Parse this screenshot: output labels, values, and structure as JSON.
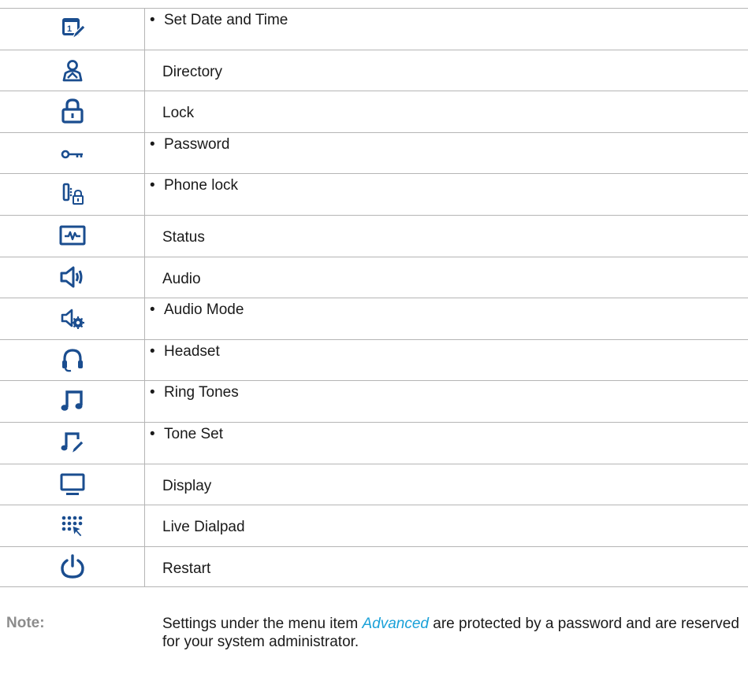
{
  "rows": [
    {
      "label": "Set Date and Time",
      "bullet": "•",
      "icon": "calendar-edit-icon"
    },
    {
      "label": "Directory",
      "icon": "directory-icon"
    },
    {
      "label": "Lock",
      "icon": "lock-icon"
    },
    {
      "label": "Password",
      "bullet": "•",
      "icon": "key-icon"
    },
    {
      "label": "Phone lock",
      "bullet": "•",
      "icon": "phone-lock-icon"
    },
    {
      "label": "Status",
      "icon": "status-monitor-icon"
    },
    {
      "label": "Audio",
      "icon": "speaker-icon"
    },
    {
      "label": "Audio Mode",
      "bullet": "•",
      "icon": "audio-mode-icon"
    },
    {
      "label": "Headset",
      "bullet": "•",
      "icon": "headset-icon"
    },
    {
      "label": "Ring Tones",
      "bullet": "•",
      "icon": "music-note-icon"
    },
    {
      "label": "Tone Set",
      "bullet": "•",
      "icon": "tone-set-icon"
    },
    {
      "label": "Display",
      "icon": "display-icon"
    },
    {
      "label": "Live Dialpad",
      "icon": "live-dialpad-icon"
    },
    {
      "label": "Restart",
      "icon": "power-icon"
    }
  ],
  "note": {
    "label": "Note:",
    "text_before": "Settings under the menu item ",
    "link": "Advanced",
    "text_after": " are protected by a password and are reserved for your system administrator."
  },
  "colors": {
    "icon": "#1a4d8f",
    "link": "#1aa1d8",
    "note_label": "#8c8c8c",
    "border": "#b5b5b5"
  }
}
